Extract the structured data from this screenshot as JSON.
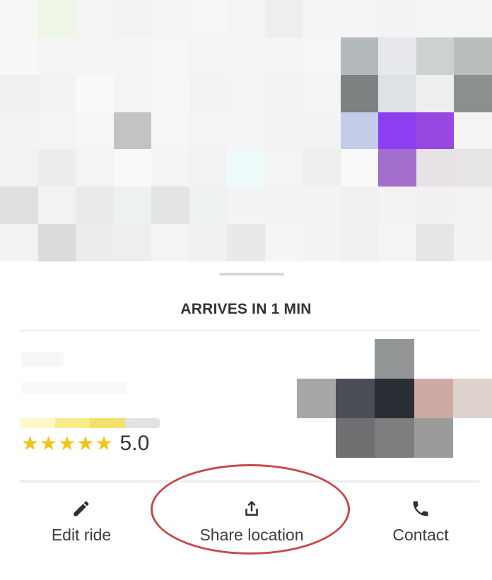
{
  "sheet": {
    "arrival_title": "ARRIVES IN 1 MIN",
    "rating": "5.0",
    "star_count": 5
  },
  "actions": [
    {
      "label": "Edit ride",
      "icon": "pencil-icon"
    },
    {
      "label": "Share location",
      "icon": "share-icon"
    },
    {
      "label": "Contact",
      "icon": "phone-icon"
    }
  ],
  "colors": {
    "star": "#f0c419",
    "highlight_ring": "#c64a4a",
    "text": "#333333"
  }
}
